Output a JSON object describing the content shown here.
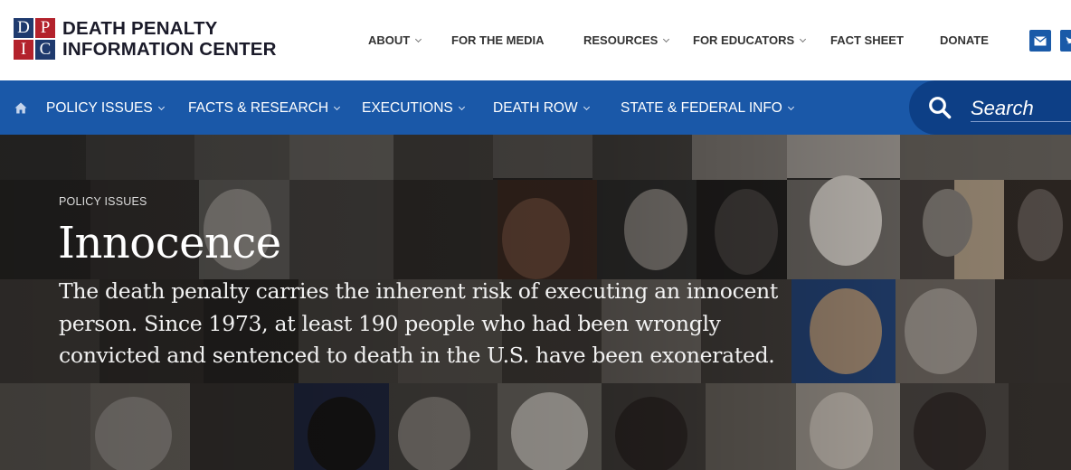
{
  "logo": {
    "letters": [
      "D",
      "P",
      "I",
      "C"
    ],
    "line1": "DEATH PENALTY",
    "line2": "INFORMATION CENTER"
  },
  "top_nav": [
    {
      "label": "ABOUT",
      "has_dropdown": true
    },
    {
      "label": "FOR THE MEDIA",
      "has_dropdown": false
    },
    {
      "label": "RESOURCES",
      "has_dropdown": true
    },
    {
      "label": "FOR EDUCATORS",
      "has_dropdown": true
    },
    {
      "label": "FACT SHEET",
      "has_dropdown": false
    },
    {
      "label": "DONATE",
      "has_dropdown": false
    }
  ],
  "social": [
    "email-icon",
    "twitter-icon"
  ],
  "main_nav": [
    {
      "label": "POLICY ISSUES",
      "has_dropdown": true
    },
    {
      "label": "FACTS & RESEARCH",
      "has_dropdown": true
    },
    {
      "label": "EXECUTIONS",
      "has_dropdown": true
    },
    {
      "label": "DEATH ROW",
      "has_dropdown": true
    },
    {
      "label": "STATE & FEDERAL INFO",
      "has_dropdown": true
    }
  ],
  "search": {
    "label": "Search"
  },
  "hero": {
    "breadcrumb": "POLICY ISSUES",
    "title": "Innocence",
    "description": "The death penalty carries the inherent risk of executing an innocent person. Since 1973, at least 190 people who had been wrongly convicted and sentenced to death in the U.S. have been exonerated."
  },
  "colors": {
    "nav_blue": "#1a58a8",
    "search_blue": "#0d3f86",
    "logo_navy": "#1f3a6e",
    "logo_red": "#b3222c"
  }
}
